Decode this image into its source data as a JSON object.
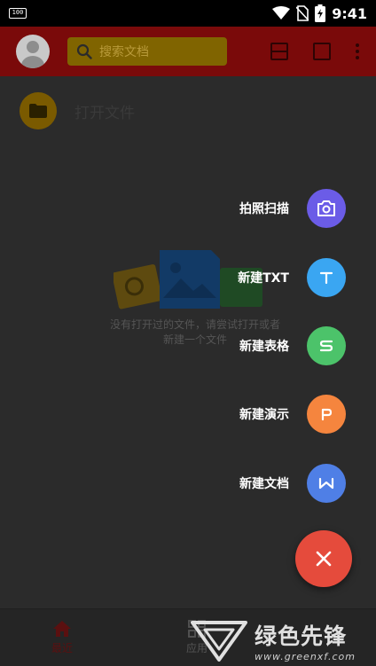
{
  "status_bar": {
    "battery_small": "100",
    "time": "9:41"
  },
  "app_bar": {
    "search_placeholder": "搜索文档"
  },
  "recent": {
    "open_file_label": "打开文件"
  },
  "empty_state": {
    "line1": "没有打开过的文件，请尝试打开或者",
    "line2": "新建一个文件"
  },
  "fab_menu": {
    "items": [
      {
        "label": "拍照扫描",
        "icon": "camera-icon",
        "color": "#6b5ce7"
      },
      {
        "label": "新建TXT",
        "icon": "t-icon",
        "color": "#3aa6f2"
      },
      {
        "label": "新建表格",
        "icon": "s-icon",
        "color": "#4cc36a"
      },
      {
        "label": "新建演示",
        "icon": "p-icon",
        "color": "#f5853e"
      },
      {
        "label": "新建文档",
        "icon": "w-icon",
        "color": "#4f7fe6"
      }
    ],
    "close_color": "#e54b3c"
  },
  "bottom_nav": {
    "recent_label": "最近",
    "apps_label": "应用"
  },
  "watermark": {
    "name": "绿色先锋",
    "url": "www.greenxf.com"
  }
}
